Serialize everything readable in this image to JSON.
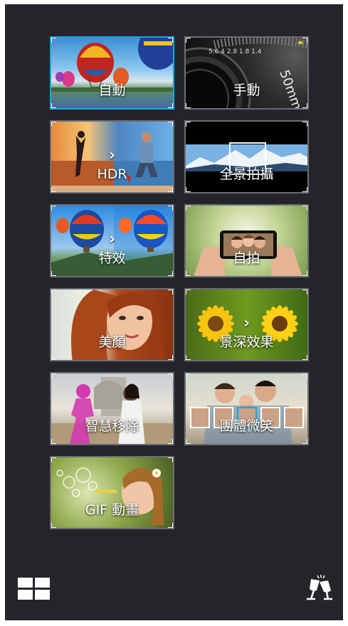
{
  "modes": [
    {
      "label": "自動",
      "icon": "hot-air-balloon-icon",
      "selected": true
    },
    {
      "label": "手動",
      "icon": "camera-lens-icon",
      "selected": false
    },
    {
      "label": "HDR",
      "icon": "hdr-icon",
      "selected": false
    },
    {
      "label": "全景拍攝",
      "icon": "panorama-icon",
      "selected": false
    },
    {
      "label": "特效",
      "icon": "effect-icon",
      "selected": false
    },
    {
      "label": "自拍",
      "icon": "selfie-icon",
      "selected": false
    },
    {
      "label": "美顏",
      "icon": "beautification-icon",
      "selected": false
    },
    {
      "label": "景深效果",
      "icon": "depth-of-field-icon",
      "selected": false
    },
    {
      "label": "智慧移除",
      "icon": "smart-remove-icon",
      "selected": false
    },
    {
      "label": "團體微笑",
      "icon": "all-smiles-icon",
      "selected": false
    },
    {
      "label": "GIF 動畫",
      "icon": "gif-animation-icon",
      "selected": false
    }
  ],
  "toolbar": {
    "left_icon": "grid-view-icon",
    "right_icon": "toast-glasses-icon"
  },
  "colors": {
    "background": "#23252b",
    "selected_border": "#1aa6d8",
    "tile_border": "#6b6e74"
  }
}
